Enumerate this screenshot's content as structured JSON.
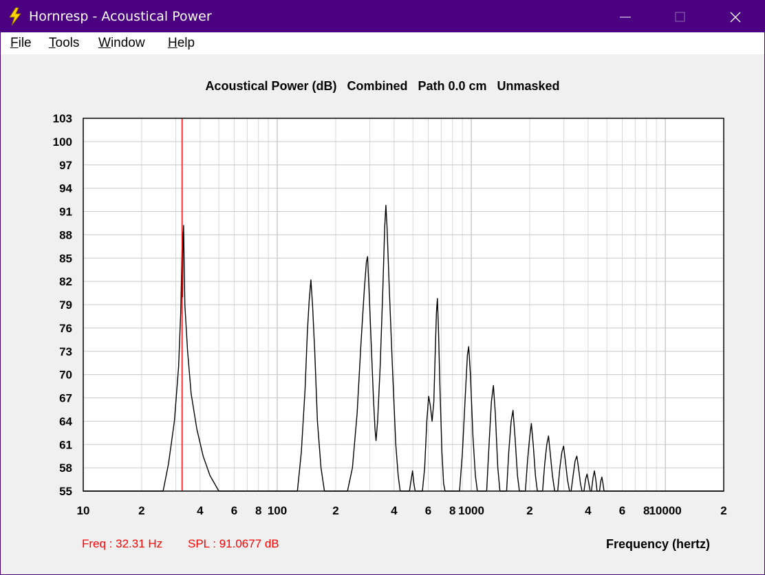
{
  "window": {
    "title": "Hornresp - Acoustical Power",
    "icon": "lightning-icon",
    "controls": [
      "minimize-icon",
      "maximize-icon",
      "close-icon"
    ]
  },
  "menu": {
    "items": [
      {
        "label": "File",
        "accel": "F"
      },
      {
        "label": "Tools",
        "accel": "T"
      },
      {
        "label": "Window",
        "accel": "W"
      },
      {
        "label": "Help",
        "accel": "H"
      }
    ]
  },
  "chart_title": "Acoustical Power (dB)   Combined   Path 0.0 cm   Unmasked",
  "readout": {
    "freq": "Freq : 32.31 Hz",
    "spl": "SPL : 91.0677 dB"
  },
  "colors": {
    "titlebar": "#4b0082",
    "cursor": "#ff0000",
    "curve": "#000000",
    "grid": "#c8c8c8"
  },
  "chart_data": {
    "type": "line",
    "title": "Acoustical Power (dB)   Combined   Path 0.0 cm   Unmasked",
    "xlabel": "Frequency (hertz)",
    "ylabel": "",
    "xscale": "log",
    "xlim": [
      10,
      20000
    ],
    "ylim": [
      55,
      103
    ],
    "yticks": [
      103,
      100,
      97,
      94,
      91,
      88,
      85,
      82,
      79,
      76,
      73,
      70,
      67,
      64,
      61,
      58,
      55
    ],
    "xticks": [
      {
        "v": 10,
        "label": "10"
      },
      {
        "v": 20,
        "label": "2"
      },
      {
        "v": 40,
        "label": "4"
      },
      {
        "v": 60,
        "label": "6"
      },
      {
        "v": 80,
        "label": "8"
      },
      {
        "v": 100,
        "label": "100"
      },
      {
        "v": 200,
        "label": "2"
      },
      {
        "v": 400,
        "label": "4"
      },
      {
        "v": 600,
        "label": "6"
      },
      {
        "v": 800,
        "label": "8"
      },
      {
        "v": 1000,
        "label": "1000"
      },
      {
        "v": 2000,
        "label": "2"
      },
      {
        "v": 4000,
        "label": "4"
      },
      {
        "v": 6000,
        "label": "6"
      },
      {
        "v": 8000,
        "label": "8"
      },
      {
        "v": 10000,
        "label": "10000"
      },
      {
        "v": 20000,
        "label": "2"
      }
    ],
    "grid": true,
    "cursor": {
      "freq": 32.31,
      "spl": 91.0677
    },
    "series": [
      {
        "name": "",
        "points": [
          [
            10,
            55
          ],
          [
            25.8,
            55
          ],
          [
            27.5,
            58.5
          ],
          [
            29.5,
            64
          ],
          [
            31,
            71
          ],
          [
            31.8,
            78
          ],
          [
            32.1,
            83
          ],
          [
            32.3,
            86
          ],
          [
            32.5,
            80
          ],
          [
            32.7,
            88
          ],
          [
            32.9,
            89.2
          ],
          [
            33.1,
            85
          ],
          [
            33.4,
            79
          ],
          [
            34.5,
            73
          ],
          [
            36,
            67.5
          ],
          [
            38.5,
            63
          ],
          [
            41.5,
            59.5
          ],
          [
            45,
            57
          ],
          [
            50,
            55
          ],
          [
            127,
            55
          ],
          [
            133,
            60
          ],
          [
            139,
            68
          ],
          [
            143,
            75.5
          ],
          [
            146,
            79.5
          ],
          [
            149,
            82.2
          ],
          [
            152,
            79
          ],
          [
            156,
            73
          ],
          [
            161,
            64
          ],
          [
            168,
            58
          ],
          [
            175,
            55
          ],
          [
            230,
            55
          ],
          [
            244,
            58
          ],
          [
            258,
            65
          ],
          [
            270,
            74
          ],
          [
            281,
            81
          ],
          [
            288,
            84.5
          ],
          [
            292,
            85.2
          ],
          [
            297,
            81
          ],
          [
            305,
            74
          ],
          [
            313,
            67
          ],
          [
            319,
            63
          ],
          [
            323,
            61.5
          ],
          [
            329,
            64
          ],
          [
            339,
            71
          ],
          [
            350,
            81
          ],
          [
            358,
            89
          ],
          [
            363,
            91.8
          ],
          [
            368,
            89
          ],
          [
            378,
            81
          ],
          [
            392,
            71
          ],
          [
            408,
            61
          ],
          [
            420,
            57
          ],
          [
            430,
            55
          ],
          [
            480,
            55
          ],
          [
            490,
            56.5
          ],
          [
            498,
            57.6
          ],
          [
            506,
            56
          ],
          [
            514,
            55
          ],
          [
            560,
            55
          ],
          [
            575,
            58
          ],
          [
            590,
            64
          ],
          [
            603,
            67.2
          ],
          [
            615,
            66
          ],
          [
            628,
            64
          ],
          [
            641,
            66.5
          ],
          [
            652,
            73
          ],
          [
            661,
            78
          ],
          [
            669,
            79.8
          ],
          [
            677,
            76
          ],
          [
            690,
            68
          ],
          [
            706,
            60
          ],
          [
            720,
            56
          ],
          [
            732,
            55
          ],
          [
            870,
            55
          ],
          [
            900,
            60
          ],
          [
            930,
            67
          ],
          [
            955,
            72.5
          ],
          [
            970,
            73.6
          ],
          [
            990,
            70
          ],
          [
            1020,
            62
          ],
          [
            1050,
            57
          ],
          [
            1075,
            55
          ],
          [
            1200,
            55
          ],
          [
            1235,
            61
          ],
          [
            1270,
            66.5
          ],
          [
            1300,
            68.6
          ],
          [
            1330,
            65
          ],
          [
            1370,
            58
          ],
          [
            1405,
            55
          ],
          [
            1520,
            55
          ],
          [
            1560,
            60
          ],
          [
            1605,
            64
          ],
          [
            1640,
            65.4
          ],
          [
            1680,
            62
          ],
          [
            1730,
            57
          ],
          [
            1770,
            55
          ],
          [
            1900,
            55
          ],
          [
            1950,
            59
          ],
          [
            2000,
            62
          ],
          [
            2040,
            63.7
          ],
          [
            2085,
            61
          ],
          [
            2140,
            57
          ],
          [
            2190,
            55
          ],
          [
            2330,
            55
          ],
          [
            2390,
            58.5
          ],
          [
            2450,
            61
          ],
          [
            2500,
            62.1
          ],
          [
            2550,
            60
          ],
          [
            2620,
            57
          ],
          [
            2690,
            55
          ],
          [
            2790,
            55
          ],
          [
            2860,
            58
          ],
          [
            2930,
            60
          ],
          [
            2990,
            60.8
          ],
          [
            3050,
            59
          ],
          [
            3130,
            56.5
          ],
          [
            3210,
            55
          ],
          [
            3270,
            55
          ],
          [
            3350,
            57
          ],
          [
            3430,
            58.9
          ],
          [
            3500,
            59.5
          ],
          [
            3570,
            58
          ],
          [
            3650,
            56
          ],
          [
            3720,
            55
          ],
          [
            3810,
            55
          ],
          [
            3880,
            56.5
          ],
          [
            3950,
            57.2
          ],
          [
            4020,
            56.2
          ],
          [
            4100,
            55
          ],
          [
            4160,
            55
          ],
          [
            4240,
            56.7
          ],
          [
            4310,
            57.6
          ],
          [
            4380,
            56.5
          ],
          [
            4450,
            55
          ],
          [
            4580,
            55
          ],
          [
            4650,
            56.3
          ],
          [
            4710,
            56.8
          ],
          [
            4770,
            56
          ],
          [
            4830,
            55
          ],
          [
            20000,
            55
          ]
        ]
      }
    ]
  }
}
